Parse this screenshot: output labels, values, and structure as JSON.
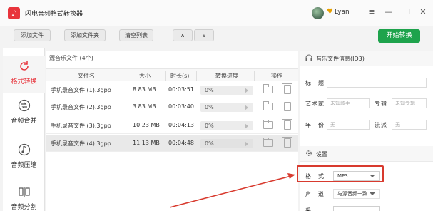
{
  "app": {
    "title": "闪电音频格式转换器",
    "logo_glyph": "♪",
    "username": "Lyan"
  },
  "window_controls": {
    "menu": "≡",
    "minimize": "—",
    "maximize": "☐",
    "close": "✕"
  },
  "toolbar": {
    "add_file": "添加文件",
    "add_folder": "添加文件夹",
    "clear_list": "清空列表",
    "move_up": "∧",
    "move_down": "∨",
    "start": "开始转换"
  },
  "sidebar": {
    "items": [
      {
        "label": "格式转换",
        "icon": "refresh-icon",
        "active": true
      },
      {
        "label": "音频合并",
        "icon": "merge-icon",
        "active": false
      },
      {
        "label": "音频压缩",
        "icon": "compress-icon",
        "active": false
      },
      {
        "label": "音频分割",
        "icon": "split-icon",
        "active": false
      }
    ]
  },
  "file_list": {
    "title": "源音乐文件 (4个)",
    "columns": [
      "文件名",
      "大小",
      "时长(s)",
      "转换进度",
      "操作"
    ],
    "rows": [
      {
        "name": "手机录音文件 (1).3gpp",
        "size": "8.83 MB",
        "duration": "00:03:51",
        "progress": "0%",
        "selected": false
      },
      {
        "name": "手机录音文件 (2).3gpp",
        "size": "3.83 MB",
        "duration": "00:03:40",
        "progress": "0%",
        "selected": false
      },
      {
        "name": "手机录音文件 (3).3gpp",
        "size": "10.23 MB",
        "duration": "00:04:13",
        "progress": "0%",
        "selected": false
      },
      {
        "name": "手机录音文件 (4).3gpp",
        "size": "11.13 MB",
        "duration": "00:04:48",
        "progress": "0%",
        "selected": true
      }
    ]
  },
  "info_panel": {
    "title": "音乐文件信息(ID3)",
    "fields": {
      "title_label": "标　题",
      "artist_label": "艺术家",
      "artist_placeholder": "未知歌手",
      "album_label": "专辑",
      "album_placeholder": "未知专辑",
      "year_label": "年　份",
      "year_placeholder": "无",
      "genre_label": "流派",
      "genre_placeholder": "无"
    }
  },
  "settings_panel": {
    "title": "设置",
    "format_label": "格　式",
    "format_value": "MP3",
    "channel_label": "声　道",
    "channel_value": "与源音频一致",
    "third_label": "采"
  },
  "colors": {
    "accent_red": "#e8343c",
    "start_green": "#1ea34c",
    "highlight_red": "#d83a2e"
  }
}
